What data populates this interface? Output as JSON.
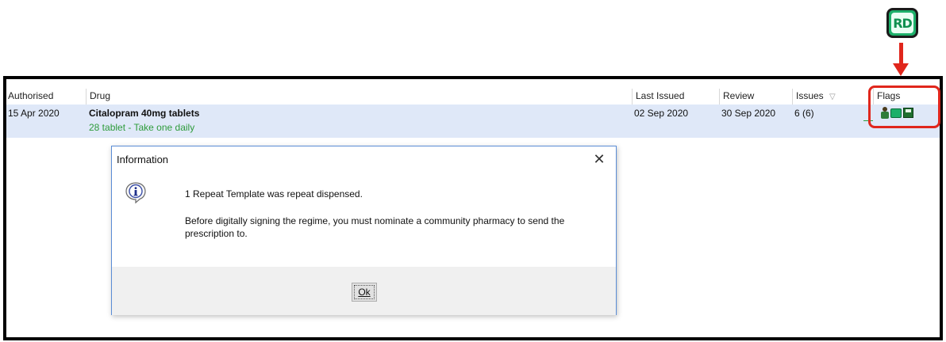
{
  "badge": {
    "label": "RD"
  },
  "grid": {
    "columns": [
      {
        "key": "authorised",
        "label": "Authorised"
      },
      {
        "key": "drug",
        "label": "Drug"
      },
      {
        "key": "last_issued",
        "label": "Last Issued"
      },
      {
        "key": "review",
        "label": "Review"
      },
      {
        "key": "issues",
        "label": "Issues"
      },
      {
        "key": "flags",
        "label": "Flags"
      }
    ],
    "sort_indicator": "▽",
    "rows": [
      {
        "authorised": "15 Apr 2020",
        "drug_name": "Citalopram 40mg tablets",
        "drug_detail": "28 tablet - Take one daily",
        "last_issued": "02 Sep 2020",
        "review": "30 Sep 2020",
        "issues": "6 (6)"
      }
    ],
    "flag_icons": [
      "person-icon",
      "repeat-dispensing-icon",
      "save-disk-icon"
    ]
  },
  "dialog": {
    "title": "Information",
    "close_label": "✕",
    "icon": "info-icon",
    "message1": "1 Repeat Template was repeat dispensed.",
    "message2": "Before digitally signing the regime, you must nominate a community pharmacy to send the prescription to.",
    "ok_label": "Ok"
  },
  "colors": {
    "highlight": "#e0261c",
    "row_selected": "#dfe8f8",
    "drug_detail": "#2e9b3b",
    "badge": "#1db06a"
  }
}
